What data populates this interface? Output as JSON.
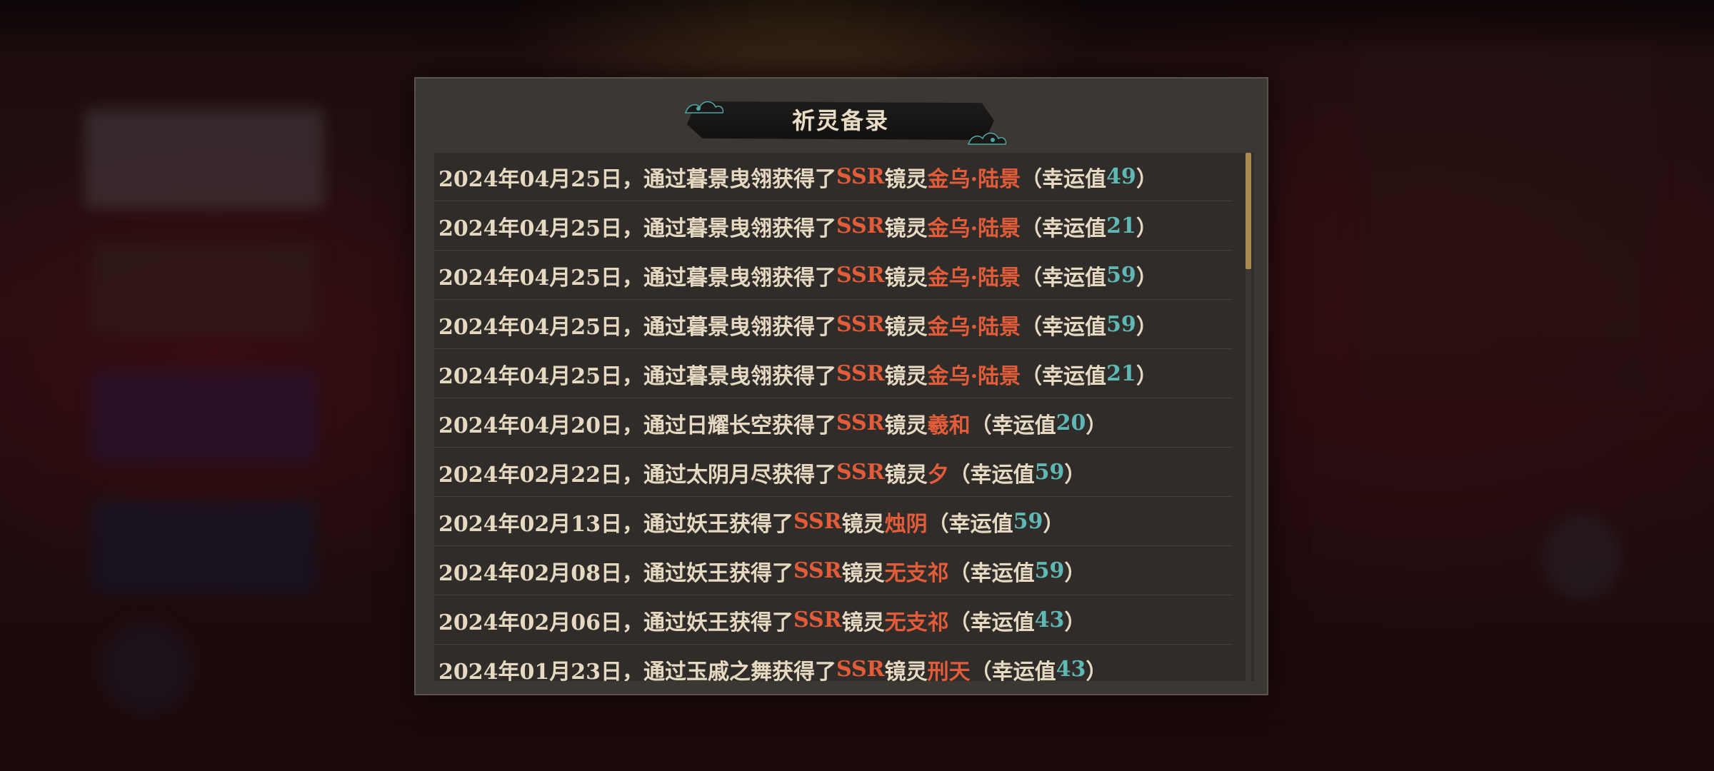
{
  "dialog": {
    "title": "祈灵备录",
    "records": [
      {
        "date": "2024年04月25日，",
        "via": "通过暮景曳翎获得了",
        "rarity": "SSR",
        "kind": "镜灵",
        "name": "金乌·陆景",
        "luck_label": "（幸运值",
        "luck": "49",
        "close": "）"
      },
      {
        "date": "2024年04月25日，",
        "via": "通过暮景曳翎获得了",
        "rarity": "SSR",
        "kind": "镜灵",
        "name": "金乌·陆景",
        "luck_label": "（幸运值",
        "luck": "21",
        "close": "）"
      },
      {
        "date": "2024年04月25日，",
        "via": "通过暮景曳翎获得了",
        "rarity": "SSR",
        "kind": "镜灵",
        "name": "金乌·陆景",
        "luck_label": "（幸运值",
        "luck": "59",
        "close": "）"
      },
      {
        "date": "2024年04月25日，",
        "via": "通过暮景曳翎获得了",
        "rarity": "SSR",
        "kind": "镜灵",
        "name": "金乌·陆景",
        "luck_label": "（幸运值",
        "luck": "59",
        "close": "）"
      },
      {
        "date": "2024年04月25日，",
        "via": "通过暮景曳翎获得了",
        "rarity": "SSR",
        "kind": "镜灵",
        "name": "金乌·陆景",
        "luck_label": "（幸运值",
        "luck": "21",
        "close": "）"
      },
      {
        "date": "2024年04月20日，",
        "via": "通过日耀长空获得了",
        "rarity": "SSR",
        "kind": "镜灵",
        "name": "羲和",
        "luck_label": "（幸运值",
        "luck": "20",
        "close": "）"
      },
      {
        "date": "2024年02月22日，",
        "via": "通过太阴月尽获得了",
        "rarity": "SSR",
        "kind": "镜灵",
        "name": "夕",
        "luck_label": "（幸运值",
        "luck": "59",
        "close": "）"
      },
      {
        "date": "2024年02月13日，",
        "via": "通过妖王获得了",
        "rarity": "SSR",
        "kind": "镜灵",
        "name": "烛阴",
        "luck_label": "（幸运值",
        "luck": "59",
        "close": "）"
      },
      {
        "date": "2024年02月08日，",
        "via": "通过妖王获得了",
        "rarity": "SSR",
        "kind": "镜灵",
        "name": "无支祁",
        "luck_label": "（幸运值",
        "luck": "59",
        "close": "）"
      },
      {
        "date": "2024年02月06日，",
        "via": "通过妖王获得了",
        "rarity": "SSR",
        "kind": "镜灵",
        "name": "无支祁",
        "luck_label": "（幸运值",
        "luck": "43",
        "close": "）"
      },
      {
        "date": "2024年01月23日，",
        "via": "通过玉戚之舞获得了",
        "rarity": "SSR",
        "kind": "镜灵",
        "name": "刑天",
        "luck_label": "（幸运值",
        "luck": "43",
        "close": "）"
      }
    ]
  },
  "colors": {
    "rarity": "#e25c3a",
    "luck": "#5fb8b4",
    "text": "#e6d9c2",
    "scroll_thumb": "#a88a52"
  },
  "scroll": {
    "position_fraction": 0.0,
    "visible_fraction": 0.22
  }
}
